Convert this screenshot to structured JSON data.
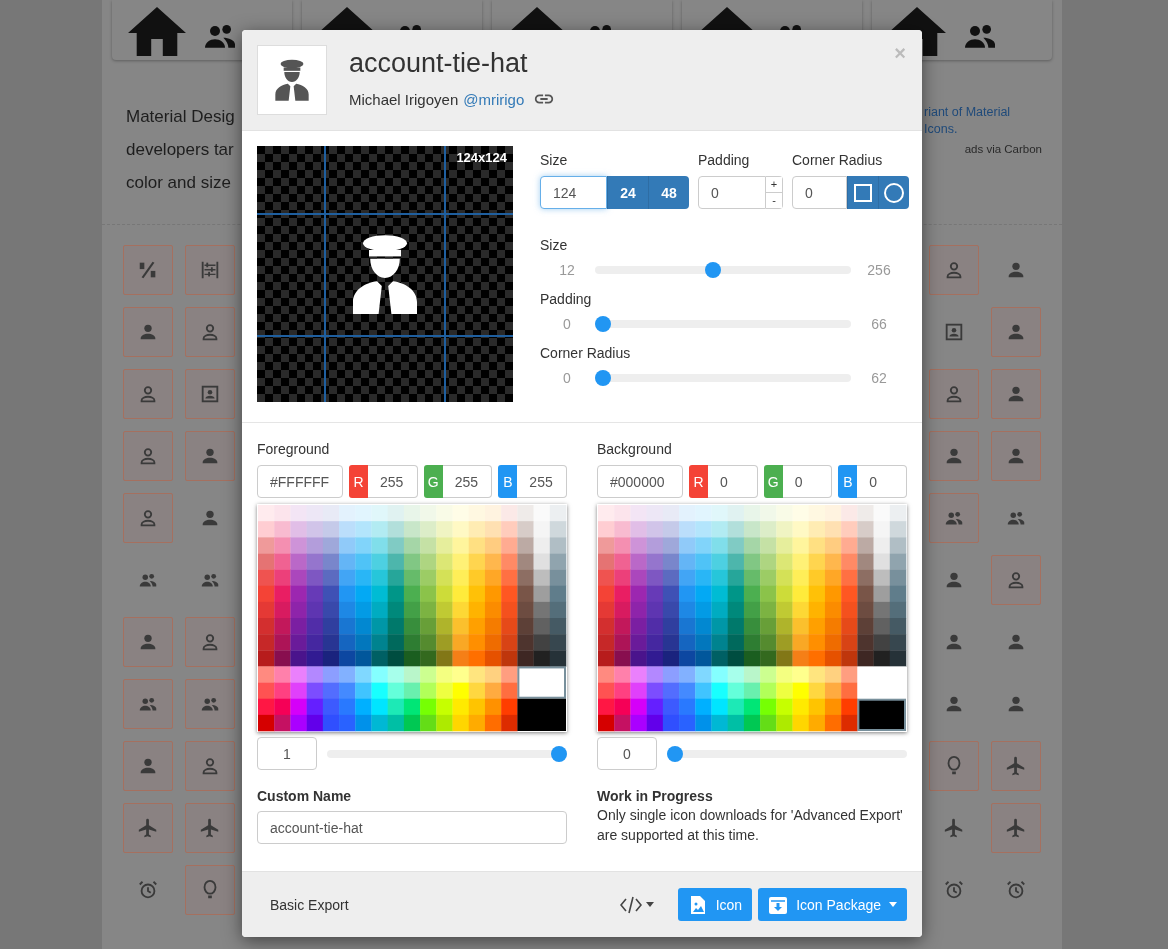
{
  "page": {
    "intro_lines": [
      "Material Desig",
      "developers tar",
      "color and size"
    ],
    "ad_lines": [
      "riant of Material",
      "Icons."
    ],
    "ad_credit": "ads via Carbon",
    "left_tiles": [
      {
        "bordered": true
      },
      {
        "bordered": true
      },
      {
        "bordered": true
      },
      {
        "bordered": true
      },
      {
        "bordered": true
      },
      {
        "bordered": true
      },
      {
        "bordered": true
      },
      {
        "bordered": true
      },
      {
        "bordered": true
      },
      {
        "bordered": false
      },
      {
        "bordered": false
      },
      {
        "bordered": false
      },
      {
        "bordered": true
      },
      {
        "bordered": true
      },
      {
        "bordered": true
      },
      {
        "bordered": true
      },
      {
        "bordered": true
      },
      {
        "bordered": true
      },
      {
        "bordered": true
      },
      {
        "bordered": true
      },
      {
        "bordered": false
      },
      {
        "bordered": true
      }
    ],
    "right_tiles": [
      {
        "bordered": true
      },
      {
        "bordered": false
      },
      {
        "bordered": false
      },
      {
        "bordered": true
      },
      {
        "bordered": true
      },
      {
        "bordered": true
      },
      {
        "bordered": true
      },
      {
        "bordered": true
      },
      {
        "bordered": true
      },
      {
        "bordered": false
      },
      {
        "bordered": false
      },
      {
        "bordered": true
      },
      {
        "bordered": false
      },
      {
        "bordered": false
      },
      {
        "bordered": false
      },
      {
        "bordered": false
      },
      {
        "bordered": true
      },
      {
        "bordered": true
      },
      {
        "bordered": false
      },
      {
        "bordered": true
      },
      {
        "bordered": false
      },
      {
        "bordered": false
      }
    ]
  },
  "modal": {
    "title": "account-tie-hat",
    "author": "Michael Irigoyen",
    "author_handle": "@mririgo",
    "close_symbol": "×",
    "preview": {
      "dimensions": "124x124"
    },
    "size": {
      "label": "Size",
      "value": "124",
      "focused": true,
      "presets": [
        "24",
        "48"
      ]
    },
    "padding": {
      "label": "Padding",
      "value": "0",
      "increment": "+",
      "decrement": "-"
    },
    "corner_radius": {
      "label": "Corner Radius",
      "value": "0"
    },
    "sliders": [
      {
        "label": "Size",
        "min": "12",
        "max": "256",
        "level": 0.46
      },
      {
        "label": "Padding",
        "min": "0",
        "max": "66",
        "level": 0
      },
      {
        "label": "Corner Radius",
        "min": "0",
        "max": "62",
        "level": 0
      }
    ],
    "foreground": {
      "label": "Foreground",
      "hex": "#FFFFFF",
      "channels": [
        {
          "label": "R",
          "value": "255",
          "color": "#f44336"
        },
        {
          "label": "G",
          "value": "255",
          "color": "#4caf50"
        },
        {
          "label": "B",
          "value": "255",
          "color": "#2196f3"
        }
      ],
      "fixed_swatches": [
        {
          "color": "#ffffff",
          "selected": true
        },
        {
          "color": "#000000",
          "selected": false
        }
      ],
      "opacity": "1",
      "level": 1
    },
    "background": {
      "label": "Background",
      "hex": "#000000",
      "channels": [
        {
          "label": "R",
          "value": "0",
          "color": "#f44336"
        },
        {
          "label": "G",
          "value": "0",
          "color": "#4caf50"
        },
        {
          "label": "B",
          "value": "0",
          "color": "#2196f3"
        }
      ],
      "fixed_swatches": [
        {
          "color": "#ffffff",
          "selected": false
        },
        {
          "color": "#000000",
          "selected": true
        }
      ],
      "opacity": "0",
      "level": 0
    },
    "custom_name": {
      "label": "Custom Name",
      "value": "account-tie-hat"
    },
    "notice": {
      "title": "Work in Progress",
      "text": "Only single icon downloads for 'Advanced Export' are supported at this time."
    },
    "footer": {
      "basic_export": "Basic Export",
      "icon_button": "Icon",
      "package_button": "Icon Package"
    }
  }
}
